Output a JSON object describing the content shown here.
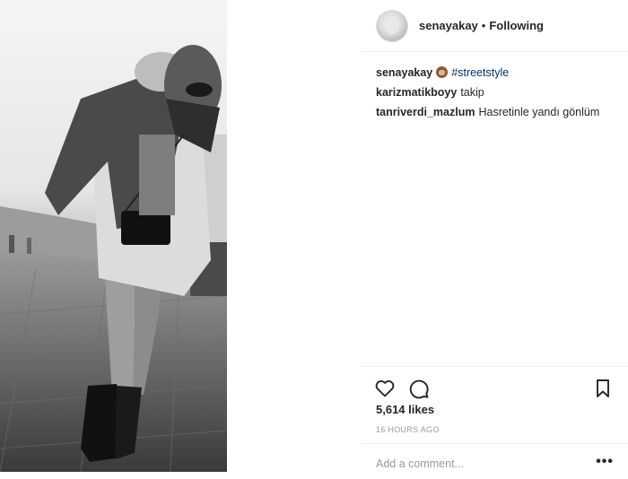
{
  "post": {
    "author": "senayakay",
    "separator": "•",
    "follow_status": "Following",
    "photo_alt_icon": "street-photo"
  },
  "comments": [
    {
      "user": "senayakay",
      "emoji": "see-no-evil-monkey-emoji",
      "text": "#streetstyle"
    },
    {
      "user": "karizmatikboyy",
      "text": "takip"
    },
    {
      "user": "tanriverdi_mazlum",
      "text": "Hasretinle yandı gönlüm"
    }
  ],
  "actions": {
    "like_icon": "heart-icon",
    "comment_icon": "comment-icon",
    "save_icon": "bookmark-icon"
  },
  "likes": "5,614 likes",
  "time": "16 HOURS AGO",
  "add_comment": {
    "placeholder": "Add a comment...",
    "more": "•••"
  },
  "colors": {
    "text": "#262626",
    "muted": "#999999",
    "hashtag": "#003569",
    "divider": "#efefef"
  }
}
